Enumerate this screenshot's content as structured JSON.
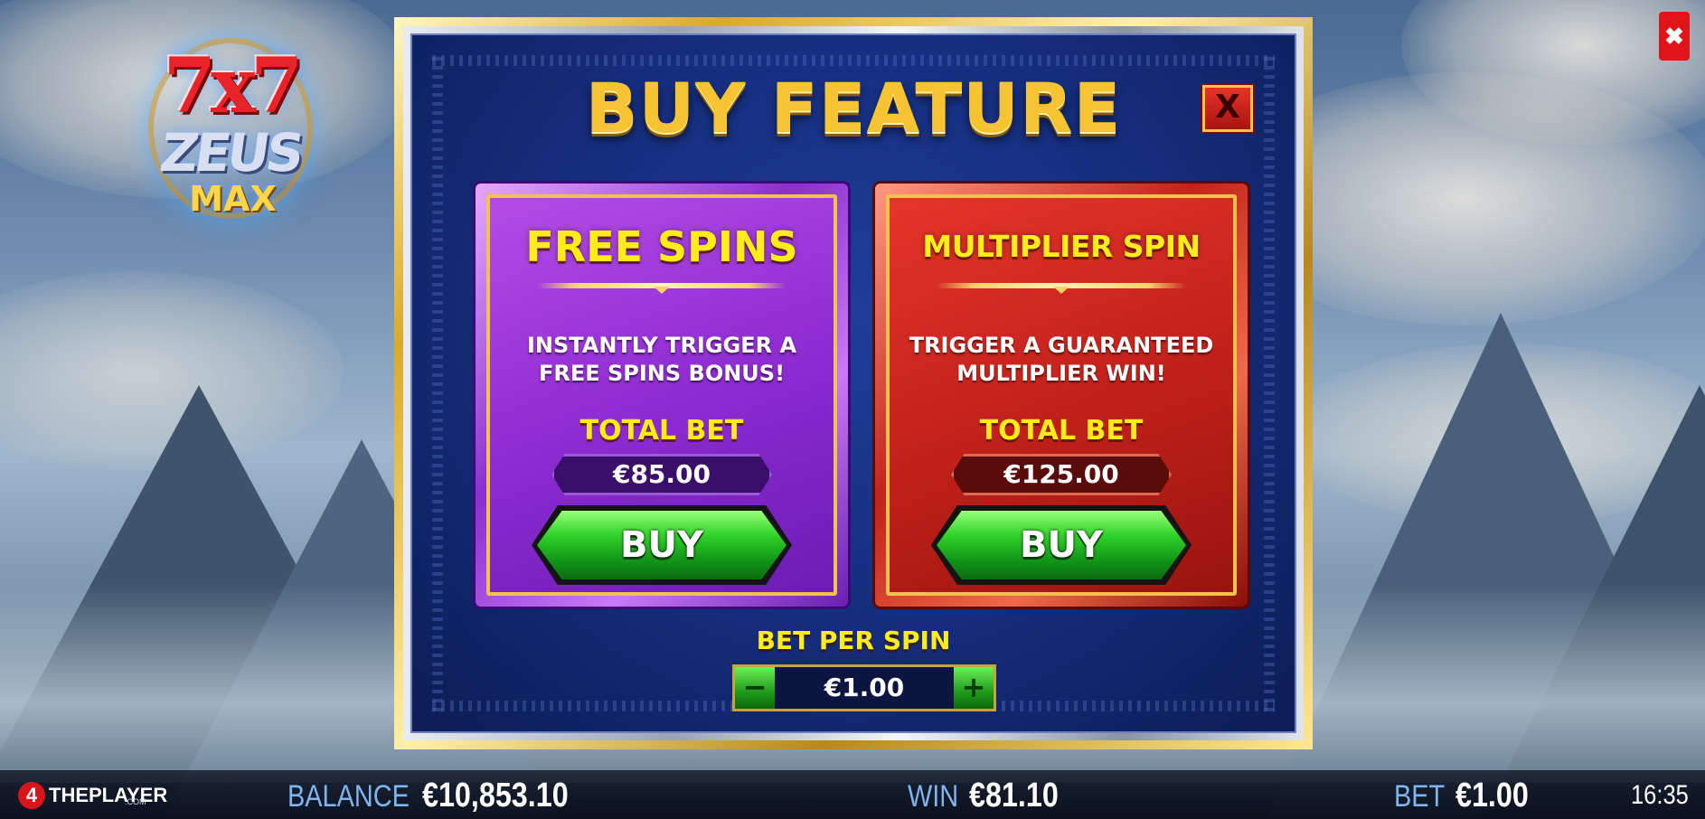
{
  "game": {
    "logo": {
      "line1": "7x7",
      "line2": "ZEUS",
      "line3": "MAX"
    }
  },
  "app_close_label": "✖",
  "buy_feature": {
    "title": "BUY FEATURE",
    "close_label": "X",
    "cards": [
      {
        "title": "FREE SPINS",
        "description": "INSTANTLY TRIGGER A FREE SPINS BONUS!",
        "total_bet_label": "TOTAL BET",
        "total_bet_value": "€85.00",
        "buy_label": "BUY"
      },
      {
        "title": "MULTIPLIER SPIN",
        "description": "TRIGGER A GUARANTEED MULTIPLIER WIN!",
        "total_bet_label": "TOTAL BET",
        "total_bet_value": "€125.00",
        "buy_label": "BUY"
      }
    ],
    "bet_per_spin": {
      "label": "BET PER SPIN",
      "value": "€1.00",
      "decrease_label": "−",
      "increase_label": "+"
    }
  },
  "bottom_bar": {
    "brand_badge": "4",
    "brand_name": "THEPLAYER",
    "brand_suffix": ".COM",
    "balance_label": "BALANCE",
    "balance_value": "€10,853.10",
    "win_label": "WIN",
    "win_value": "€81.10",
    "bet_label": "BET",
    "bet_value": "€1.00",
    "clock": "16:35"
  },
  "colors": {
    "gold_text": "#ffec1a",
    "free_spins_card": "#8b2ad0",
    "multiplier_card": "#c0201a",
    "buy_button": "#31d42a",
    "close_red": "#e1141a",
    "stat_label_blue": "#7fb4ec"
  },
  "icons": {
    "app_close": "close-icon",
    "modal_close": "close-icon",
    "decrease": "minus-icon",
    "increase": "plus-icon"
  }
}
